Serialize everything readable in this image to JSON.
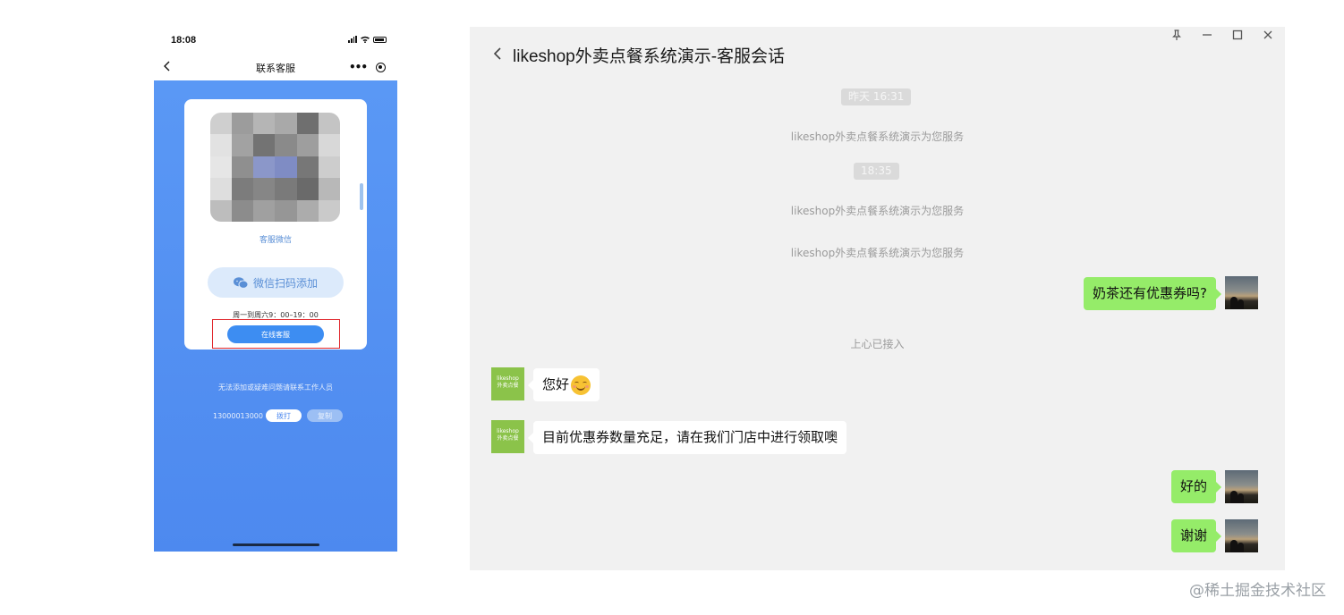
{
  "phone": {
    "status_time": "18:08",
    "nav_title": "联系客服",
    "qr_caption": "客服微信",
    "wechat_button_label": "微信扫码添加",
    "hours": "周一到周六9：00–19：00",
    "online_button_label": "在线客服",
    "help_text": "无法添加或疑难问题请联系工作人员",
    "phone_number": "13000013000",
    "call_button_label": "拨打",
    "copy_button_label": "复制",
    "colors": {
      "background": "#5a98f5",
      "accent": "#3d8df2",
      "highlight_border": "#e0262b"
    }
  },
  "chat": {
    "title": "likeshop外卖点餐系统演示-客服会话",
    "window_controls": [
      "pin-icon",
      "minimize-icon",
      "maximize-icon",
      "close-icon"
    ],
    "timestamps": [
      "昨天 16:31",
      "18:35"
    ],
    "system_messages": [
      "likeshop外卖点餐系统演示为您服务",
      "likeshop外卖点餐系统演示为您服务",
      "likeshop外卖点餐系统演示为您服务",
      "上心已接入"
    ],
    "messages": [
      {
        "side": "right",
        "text": "奶茶还有优惠券吗?"
      },
      {
        "side": "left",
        "text": "您好"
      },
      {
        "side": "left",
        "text": "目前优惠券数量充足，请在我们门店中进行领取噢"
      },
      {
        "side": "right",
        "text": "好的"
      },
      {
        "side": "right",
        "text": "谢谢"
      }
    ],
    "shop_avatar_text": [
      "likeshop",
      "外卖点餐"
    ],
    "colors": {
      "background": "#f1f1f1",
      "self_bubble": "#95ec69",
      "other_bubble": "#ffffff"
    }
  },
  "watermark": "@稀土掘金技术社区"
}
